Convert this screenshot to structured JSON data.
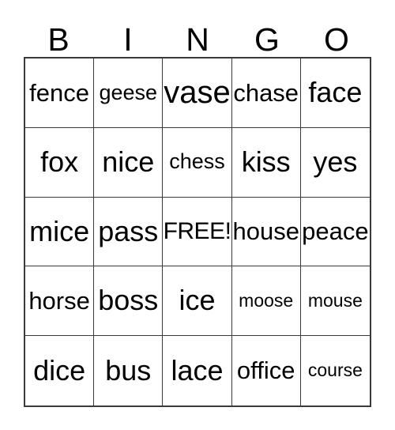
{
  "card": {
    "title_letters": [
      "B",
      "I",
      "N",
      "G",
      "O"
    ],
    "free_space": "FREE!",
    "colors": {
      "background": "#ffffff",
      "grid_line": "#3a3a3a",
      "text": "#000000"
    },
    "rows": [
      [
        {
          "text": "fence",
          "size": "md"
        },
        {
          "text": "geese",
          "size": "sm"
        },
        {
          "text": "vase",
          "size": "xl"
        },
        {
          "text": "chase",
          "size": "md"
        },
        {
          "text": "face",
          "size": "lg"
        }
      ],
      [
        {
          "text": "fox",
          "size": "lg"
        },
        {
          "text": "nice",
          "size": "lg"
        },
        {
          "text": "chess",
          "size": "sm"
        },
        {
          "text": "kiss",
          "size": "lg"
        },
        {
          "text": "yes",
          "size": "lg"
        }
      ],
      [
        {
          "text": "mice",
          "size": "lg"
        },
        {
          "text": "pass",
          "size": "lg"
        },
        {
          "text": "FREE!",
          "size": "free"
        },
        {
          "text": "house",
          "size": "md"
        },
        {
          "text": "peace",
          "size": "md"
        }
      ],
      [
        {
          "text": "horse",
          "size": "md"
        },
        {
          "text": "boss",
          "size": "lg"
        },
        {
          "text": "ice",
          "size": "lg"
        },
        {
          "text": "moose",
          "size": "xs"
        },
        {
          "text": "mouse",
          "size": "xs"
        }
      ],
      [
        {
          "text": "dice",
          "size": "lg"
        },
        {
          "text": "bus",
          "size": "lg"
        },
        {
          "text": "lace",
          "size": "lg"
        },
        {
          "text": "office",
          "size": "md"
        },
        {
          "text": "course",
          "size": "xs"
        }
      ]
    ]
  }
}
